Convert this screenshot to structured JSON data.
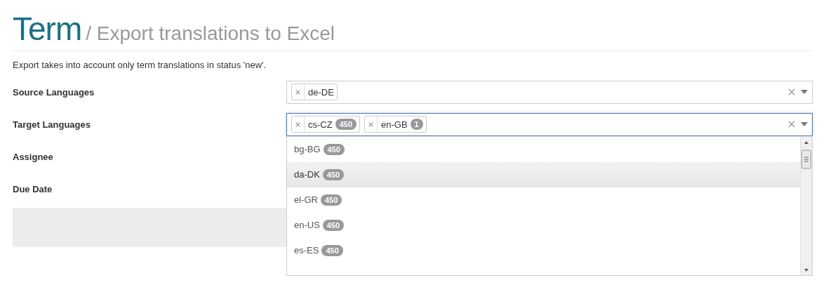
{
  "header": {
    "title": "Term",
    "subtitle": "/ Export translations to Excel"
  },
  "description": "Export takes into account only term translations in status 'new'.",
  "form": {
    "fields": [
      {
        "label": "Source Languages",
        "kind": "multiselect",
        "focused": false,
        "tags": [
          {
            "label": "de-DE"
          }
        ]
      },
      {
        "label": "Target Languages",
        "kind": "multiselect",
        "focused": true,
        "tags": [
          {
            "label": "cs-CZ",
            "count": "450"
          },
          {
            "label": "en-GB",
            "count": "1"
          }
        ],
        "dropdown": {
          "options": [
            {
              "label": "bg-BG",
              "count": "450",
              "highlighted": false
            },
            {
              "label": "da-DK",
              "count": "450",
              "highlighted": true
            },
            {
              "label": "el-GR",
              "count": "450",
              "highlighted": false
            },
            {
              "label": "en-US",
              "count": "450",
              "highlighted": false
            },
            {
              "label": "es-ES",
              "count": "450",
              "highlighted": false
            }
          ]
        }
      },
      {
        "label": "Assignee",
        "kind": "empty"
      },
      {
        "label": "Due Date",
        "kind": "empty"
      }
    ]
  }
}
